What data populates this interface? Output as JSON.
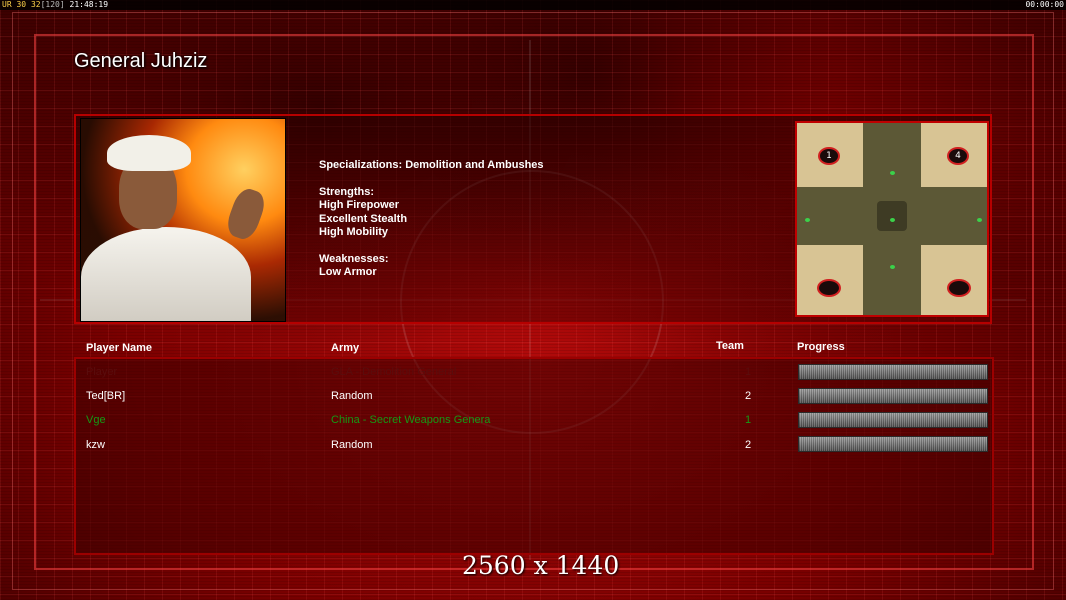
{
  "hud": {
    "left_parts": [
      "UR",
      "30",
      "32",
      "[120]",
      "21:48:19"
    ],
    "right_time": "00:00:00"
  },
  "general": {
    "name": "General Juhziz",
    "specializations": "Specializations: Demolition and Ambushes",
    "strengths_heading": "Strengths:",
    "strengths": [
      "High Firepower",
      "Excellent Stealth",
      "High Mobility"
    ],
    "weaknesses_heading": "Weaknesses:",
    "weaknesses": [
      "Low Armor"
    ]
  },
  "minimap": {
    "start_labels": [
      "1",
      "4"
    ]
  },
  "players_table": {
    "columns": [
      "Player Name",
      "Army",
      "Team",
      "Progress"
    ],
    "rows": [
      {
        "name": "Player",
        "army": "GLA - Demolition General",
        "team": "1",
        "style": "dim",
        "progress_pct": 100
      },
      {
        "name": "Ted[BR]",
        "army": "Random",
        "team": "2",
        "style": "normal",
        "progress_pct": 100
      },
      {
        "name": "Vge",
        "army": "China - Secret Weapons Genera",
        "team": "1",
        "style": "green",
        "progress_pct": 100
      },
      {
        "name": "kzw",
        "army": "Random",
        "team": "2",
        "style": "normal",
        "progress_pct": 100
      }
    ]
  },
  "resolution_label": "2560 x 1440"
}
